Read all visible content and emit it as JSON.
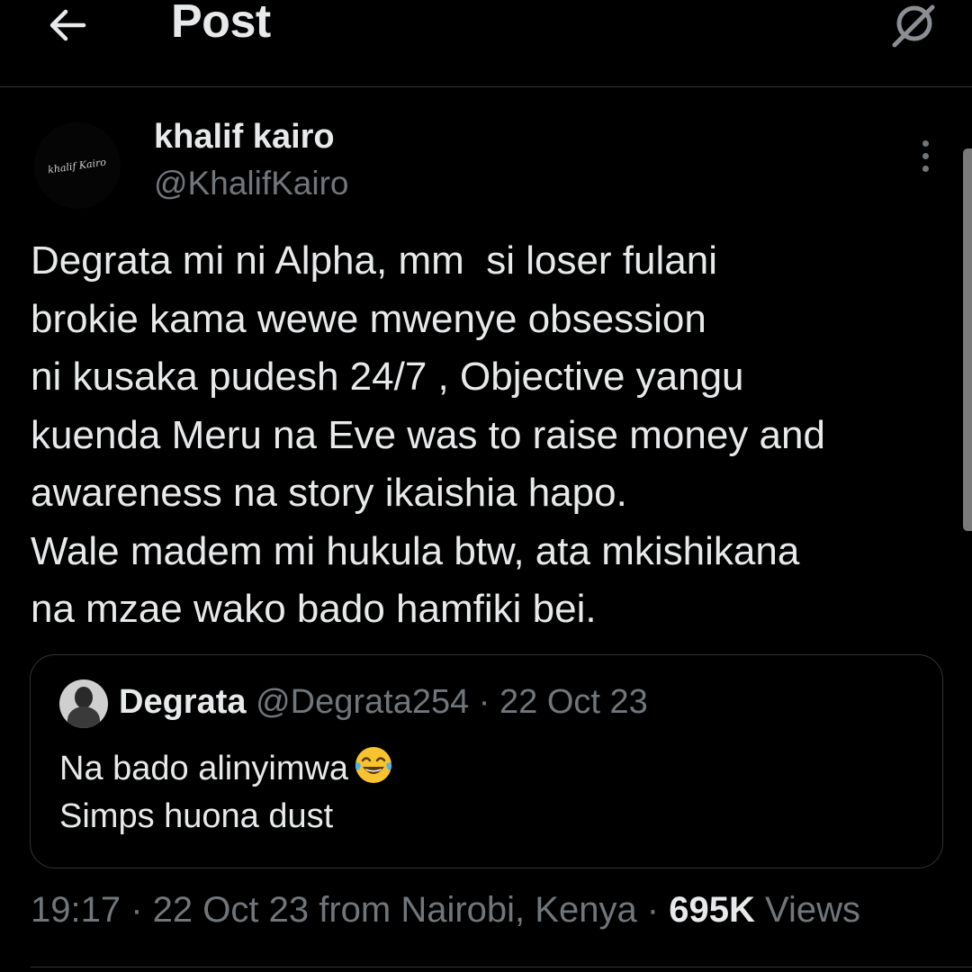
{
  "header": {
    "title": "Post",
    "back_icon": "arrow-left-icon",
    "grok_icon": "grok-icon"
  },
  "post": {
    "author": {
      "display_name": "khalif kairo",
      "handle": "@KhalifKairo",
      "avatar_logo_text": "khalif Kairo"
    },
    "body_lines": [
      "Degrata mi ni Alpha, mm  si loser fulani",
      "brokie kama wewe mwenye obsession",
      "ni kusaka pudesh 24/7 , Objective yangu",
      "kuenda Meru na Eve was to raise money and",
      "awareness na story ikaishia hapo.",
      "Wale madem mi hukula btw, ata mkishikana",
      "na mzae wako bado hamfiki bei."
    ],
    "quote": {
      "display_name": "Degrata",
      "handle": "@Degrata254",
      "separator": " · ",
      "date": "22 Oct 23",
      "text_line_1": "Na bado alinyimwa",
      "emoji": "face-with-tears-of-joy",
      "text_line_2": "Simps huona dust"
    },
    "meta": {
      "time": "19:17",
      "separator": " · ",
      "date_location": "22 Oct 23 from Nairobi, Kenya",
      "views_count": "695K",
      "views_label": "Views"
    }
  },
  "colors": {
    "background": "#000000",
    "primary_text": "#e7e9ea",
    "secondary_text": "#71767b",
    "border": "#2f3336"
  }
}
